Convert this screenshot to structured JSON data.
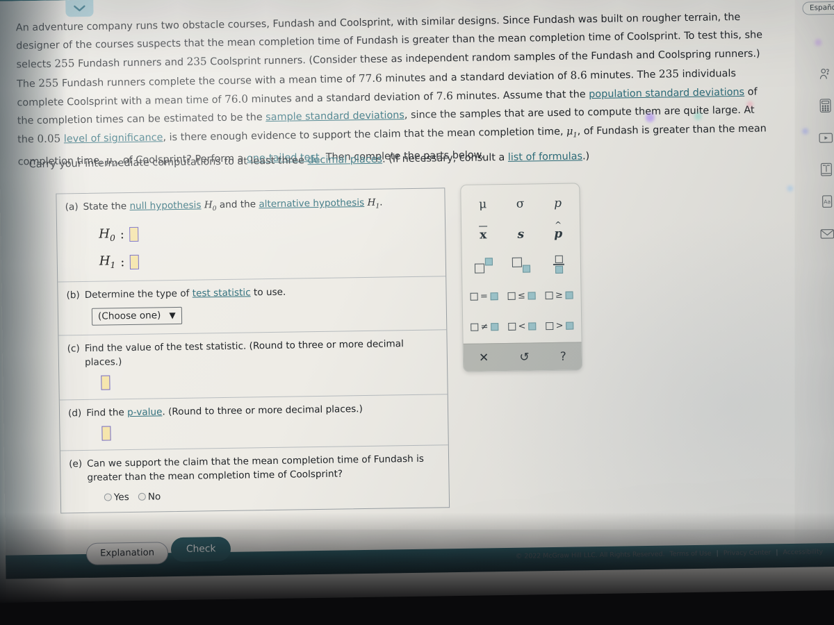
{
  "problem": {
    "paragraph_runs": [
      {
        "t": "An adventure company runs two obstacle courses, Fundash and Coolsprint, with similar designs. Since Fundash was built on rougher terrain, the designer of the courses suspects that the mean completion time of Fundash is greater than the mean completion time of Coolsprint. To test this, she selects ",
        "k": "text"
      },
      {
        "t": "255",
        "k": "num"
      },
      {
        "t": " Fundash runners and ",
        "k": "text"
      },
      {
        "t": "235",
        "k": "num"
      },
      {
        "t": " Coolsprint runners. (Consider these as independent random samples of the Fundash and Coolspring runners.) The ",
        "k": "text"
      },
      {
        "t": "255",
        "k": "num"
      },
      {
        "t": " Fundash runners complete the course with a mean time of ",
        "k": "text"
      },
      {
        "t": "77.6",
        "k": "num"
      },
      {
        "t": " minutes and a standard deviation of ",
        "k": "text"
      },
      {
        "t": "8.6",
        "k": "num"
      },
      {
        "t": " minutes. The ",
        "k": "text"
      },
      {
        "t": "235",
        "k": "num"
      },
      {
        "t": " individuals complete Coolsprint with a mean time of ",
        "k": "text"
      },
      {
        "t": "76.0",
        "k": "num"
      },
      {
        "t": " minutes and a standard deviation of ",
        "k": "text"
      },
      {
        "t": "7.6",
        "k": "num"
      },
      {
        "t": " minutes. Assume that the ",
        "k": "text"
      },
      {
        "t": "population standard deviations",
        "k": "link"
      },
      {
        "t": " of the completion times can be estimated to be the ",
        "k": "text"
      },
      {
        "t": "sample standard deviations",
        "k": "link"
      },
      {
        "t": ", since the samples that are used to compute them are quite large. At the ",
        "k": "text"
      },
      {
        "t": "0.05",
        "k": "num"
      },
      {
        "t": " ",
        "k": "text"
      },
      {
        "t": "level of significance",
        "k": "link"
      },
      {
        "t": ", is there enough evidence to support the claim that the mean completion time, ",
        "k": "text"
      },
      {
        "t": "mu1",
        "k": "math"
      },
      {
        "t": ", of Fundash is greater than the mean completion time, ",
        "k": "text"
      },
      {
        "t": "mu2",
        "k": "math"
      },
      {
        "t": ", of Coolsprint? Perform a ",
        "k": "text"
      },
      {
        "t": "one-tailed test",
        "k": "link"
      },
      {
        "t": ". Then complete the parts below.",
        "k": "text"
      }
    ],
    "carry_runs": [
      {
        "t": "Carry your intermediate computations to at least three ",
        "k": "text"
      },
      {
        "t": "decimal places",
        "k": "link"
      },
      {
        "t": ". (If necessary, consult a ",
        "k": "text"
      },
      {
        "t": "list of formulas",
        "k": "link"
      },
      {
        "t": ".)",
        "k": "text"
      }
    ]
  },
  "parts": {
    "a": {
      "label": "(a)",
      "text_1": "State the ",
      "link_1": "null hypothesis",
      "text_2": " and the ",
      "link_2": "alternative hypothesis",
      "h0_symbol": "H",
      "h0_sub": "0",
      "h1_symbol": "H",
      "h1_sub": "1",
      "colon": ":",
      "h0_value": "",
      "h1_value": "",
      "h0_placeholder": "",
      "h1_placeholder": ""
    },
    "b": {
      "label": "(b)",
      "text_1": "Determine the type of ",
      "link_1": "test statistic",
      "text_2": " to use.",
      "select_value": "(Choose one)",
      "caret": "▼",
      "options": [
        "(Choose one)"
      ]
    },
    "c": {
      "label": "(c)",
      "text_1": "Find the value of the test statistic. (Round to three or more decimal places.)",
      "value": ""
    },
    "d": {
      "label": "(d)",
      "text_1": "Find the ",
      "link_1": "p-value",
      "text_2": ". (Round to three or more decimal places.)",
      "value": ""
    },
    "e": {
      "label": "(e)",
      "text_1": "Can we support the claim that the mean completion time of Fundash is greater than the mean completion time of Coolsprint?",
      "radio_yes": "Yes",
      "radio_no": "No",
      "selected": ""
    }
  },
  "palette": {
    "cells": [
      {
        "id": "mu",
        "glyph": "μ",
        "kind": "text"
      },
      {
        "id": "sigma",
        "glyph": "σ",
        "kind": "text"
      },
      {
        "id": "p",
        "glyph": "p",
        "kind": "italic"
      },
      {
        "id": "xbar",
        "glyph": "x",
        "kind": "overline"
      },
      {
        "id": "s",
        "glyph": "s",
        "kind": "italic"
      },
      {
        "id": "phat",
        "glyph": "p",
        "kind": "hat"
      },
      {
        "id": "superscript",
        "glyph": "□^□",
        "kind": "shape-sup"
      },
      {
        "id": "subscript",
        "glyph": "□_□",
        "kind": "shape-sub"
      },
      {
        "id": "fraction",
        "glyph": "□/□",
        "kind": "shape-frac"
      },
      {
        "id": "equals",
        "glyph": "□=□",
        "kind": "rel"
      },
      {
        "id": "lessequal",
        "glyph": "□≤□",
        "kind": "rel"
      },
      {
        "id": "greaterequal",
        "glyph": "□≥□",
        "kind": "rel"
      },
      {
        "id": "notequal",
        "glyph": "□≠□",
        "kind": "rel"
      },
      {
        "id": "lessthan",
        "glyph": "□<□",
        "kind": "rel"
      },
      {
        "id": "greaterthan",
        "glyph": "□>□",
        "kind": "rel"
      }
    ],
    "footer": [
      {
        "id": "clear-button",
        "glyph": "✕"
      },
      {
        "id": "undo-button",
        "glyph": "↺"
      },
      {
        "id": "help-button",
        "glyph": "?"
      }
    ]
  },
  "rail": {
    "espanol": "Español",
    "icons": [
      {
        "name": "help-person-icon"
      },
      {
        "name": "calculator-icon"
      },
      {
        "name": "media-play-icon"
      },
      {
        "name": "reference-book-icon"
      },
      {
        "name": "text-size-icon"
      },
      {
        "name": "message-envelope-icon"
      }
    ]
  },
  "bottom": {
    "explanation_label": "Explanation",
    "check_label": "Check",
    "copyright": "© 2022 McGraw Hill LLC. All Rights Reserved.",
    "terms": "Terms of Use",
    "privacy": "Privacy Center",
    "accessibility": "Accessibility",
    "separator": "|"
  },
  "colors": {
    "link": "#2a6b78",
    "check_button": "#2d5d66",
    "input_fill": "#f5e4a8",
    "input_border": "#6b63c4",
    "palette_accent": "#9ec6cc",
    "page_background": "#eceae4"
  }
}
